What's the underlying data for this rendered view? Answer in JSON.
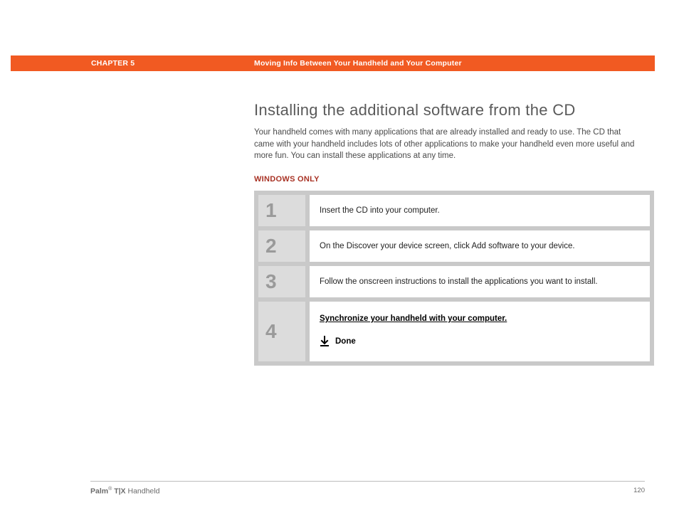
{
  "header": {
    "chapter_label": "CHAPTER 5",
    "chapter_title": "Moving Info Between Your Handheld and Your Computer"
  },
  "main": {
    "heading": "Installing the additional software from the CD",
    "intro": "Your handheld comes with many applications that are already installed and ready to use. The CD that came with your handheld includes lots of other applications to make your handheld even more useful and more fun. You can install these applications at any time.",
    "platform_tag": "WINDOWS ONLY",
    "steps": [
      {
        "num": "1",
        "text": "Insert the CD into your computer."
      },
      {
        "num": "2",
        "text": "On the Discover your device screen, click Add software to your device."
      },
      {
        "num": "3",
        "text": "Follow the onscreen instructions to install the applications you want to install."
      },
      {
        "num": "4",
        "link_text": "Synchronize your handheld with your computer.",
        "done_label": "Done"
      }
    ]
  },
  "footer": {
    "brand_bold": "Palm",
    "reg": "®",
    "model_bold": " T|X",
    "rest": " Handheld",
    "page_number": "120"
  }
}
